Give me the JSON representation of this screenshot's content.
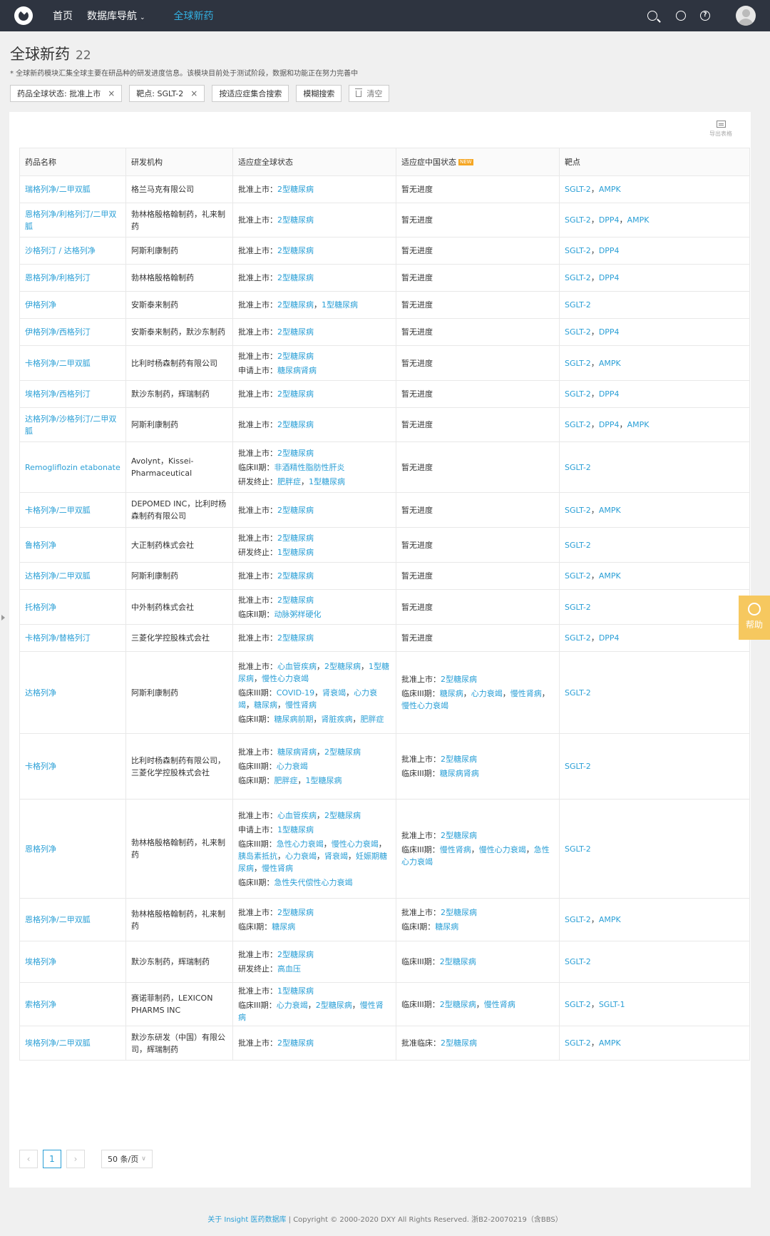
{
  "nav": {
    "items": [
      "首页",
      "数据库导航",
      "全球新药"
    ],
    "caret": "⌄"
  },
  "header": {
    "title": "全球新药",
    "count": "22",
    "desc": "* 全球新药模块汇集全球主要在研品种的研发进度信息。该模块目前处于测试阶段，数据和功能正在努力完善中"
  },
  "filters": {
    "status": "药品全球状态: 批准上市",
    "target": "靶点: SGLT-2",
    "close": "×",
    "indication_search": "按适应症集合搜索",
    "fuzzy_search": "模糊搜索",
    "clear": "清空"
  },
  "export_label": "导出表格",
  "table": {
    "headers": [
      "药品名称",
      "研发机构",
      "适应症全球状态",
      "适应症中国状态",
      "靶点"
    ],
    "new_badge": "NEW",
    "rows": [
      {
        "drug": "瑞格列净/二甲双胍",
        "org": "格兰马克有限公司",
        "global": [
          {
            "label": "批准上市：",
            "items": [
              "2型糖尿病"
            ]
          }
        ],
        "china": [
          {
            "label": "暂无进度",
            "items": []
          }
        ],
        "targets": [
          "SGLT-2",
          "AMPK"
        ]
      },
      {
        "drug": "恩格列净/利格列汀/二甲双胍",
        "org": "勃林格殷格翰制药，礼来制药",
        "global": [
          {
            "label": "批准上市：",
            "items": [
              "2型糖尿病"
            ]
          }
        ],
        "china": [
          {
            "label": "暂无进度",
            "items": []
          }
        ],
        "targets": [
          "SGLT-2",
          "DPP4",
          "AMPK"
        ]
      },
      {
        "drug": "沙格列汀 / 达格列净",
        "org": "阿斯利康制药",
        "global": [
          {
            "label": "批准上市：",
            "items": [
              "2型糖尿病"
            ]
          }
        ],
        "china": [
          {
            "label": "暂无进度",
            "items": []
          }
        ],
        "targets": [
          "SGLT-2",
          "DPP4"
        ]
      },
      {
        "drug": "恩格列净/利格列汀",
        "org": "勃林格殷格翰制药",
        "global": [
          {
            "label": "批准上市：",
            "items": [
              "2型糖尿病"
            ]
          }
        ],
        "china": [
          {
            "label": "暂无进度",
            "items": []
          }
        ],
        "targets": [
          "SGLT-2",
          "DPP4"
        ]
      },
      {
        "drug": "伊格列净",
        "org": "安斯泰来制药",
        "global": [
          {
            "label": "批准上市：",
            "items": [
              "2型糖尿病",
              "1型糖尿病"
            ]
          }
        ],
        "china": [
          {
            "label": "暂无进度",
            "items": []
          }
        ],
        "targets": [
          "SGLT-2"
        ]
      },
      {
        "drug": "伊格列净/西格列汀",
        "org": "安斯泰来制药，默沙东制药",
        "global": [
          {
            "label": "批准上市：",
            "items": [
              "2型糖尿病"
            ]
          }
        ],
        "china": [
          {
            "label": "暂无进度",
            "items": []
          }
        ],
        "targets": [
          "SGLT-2",
          "DPP4"
        ]
      },
      {
        "drug": "卡格列净/二甲双胍",
        "org": "比利时杨森制药有限公司",
        "global": [
          {
            "label": "批准上市：",
            "items": [
              "2型糖尿病"
            ]
          },
          {
            "label": "申请上市：",
            "items": [
              "糖尿病肾病"
            ]
          }
        ],
        "china": [
          {
            "label": "暂无进度",
            "items": []
          }
        ],
        "targets": [
          "SGLT-2",
          "AMPK"
        ]
      },
      {
        "drug": "埃格列净/西格列汀",
        "org": "默沙东制药，辉瑞制药",
        "global": [
          {
            "label": "批准上市：",
            "items": [
              "2型糖尿病"
            ]
          }
        ],
        "china": [
          {
            "label": "暂无进度",
            "items": []
          }
        ],
        "targets": [
          "SGLT-2",
          "DPP4"
        ]
      },
      {
        "drug": "达格列净/沙格列汀/二甲双胍",
        "org": "阿斯利康制药",
        "global": [
          {
            "label": "批准上市：",
            "items": [
              "2型糖尿病"
            ]
          }
        ],
        "china": [
          {
            "label": "暂无进度",
            "items": []
          }
        ],
        "targets": [
          "SGLT-2",
          "DPP4",
          "AMPK"
        ]
      },
      {
        "drug": "Remogliflozin etabonate",
        "org": "Avolynt，Kissei-Pharmaceutical",
        "global": [
          {
            "label": "批准上市：",
            "items": [
              "2型糖尿病"
            ]
          },
          {
            "label": "临床II期：",
            "items": [
              "非酒精性脂肪性肝炎"
            ]
          },
          {
            "label": "研发终止：",
            "items": [
              "肥胖症",
              "1型糖尿病"
            ]
          }
        ],
        "china": [
          {
            "label": "暂无进度",
            "items": []
          }
        ],
        "targets": [
          "SGLT-2"
        ]
      },
      {
        "drug": "卡格列净/二甲双胍",
        "org": "DEPOMED INC，比利时杨森制药有限公司",
        "global": [
          {
            "label": "批准上市：",
            "items": [
              "2型糖尿病"
            ]
          }
        ],
        "china": [
          {
            "label": "暂无进度",
            "items": []
          }
        ],
        "targets": [
          "SGLT-2",
          "AMPK"
        ]
      },
      {
        "drug": "鲁格列净",
        "org": "大正制药株式会社",
        "global": [
          {
            "label": "批准上市：",
            "items": [
              "2型糖尿病"
            ]
          },
          {
            "label": "研发终止：",
            "items": [
              "1型糖尿病"
            ]
          }
        ],
        "china": [
          {
            "label": "暂无进度",
            "items": []
          }
        ],
        "targets": [
          "SGLT-2"
        ]
      },
      {
        "drug": "达格列净/二甲双胍",
        "org": "阿斯利康制药",
        "global": [
          {
            "label": "批准上市：",
            "items": [
              "2型糖尿病"
            ]
          }
        ],
        "china": [
          {
            "label": "暂无进度",
            "items": []
          }
        ],
        "targets": [
          "SGLT-2",
          "AMPK"
        ]
      },
      {
        "drug": "托格列净",
        "org": "中外制药株式会社",
        "global": [
          {
            "label": "批准上市：",
            "items": [
              "2型糖尿病"
            ]
          },
          {
            "label": "临床II期：",
            "items": [
              "动脉粥样硬化"
            ]
          }
        ],
        "china": [
          {
            "label": "暂无进度",
            "items": []
          }
        ],
        "targets": [
          "SGLT-2"
        ]
      },
      {
        "drug": "卡格列净/替格列汀",
        "org": "三菱化学控股株式会社",
        "global": [
          {
            "label": "批准上市：",
            "items": [
              "2型糖尿病"
            ]
          }
        ],
        "china": [
          {
            "label": "暂无进度",
            "items": []
          }
        ],
        "targets": [
          "SGLT-2",
          "DPP4"
        ]
      },
      {
        "drug": "达格列净",
        "org": "阿斯利康制药",
        "global": [
          {
            "label": "批准上市：",
            "items": [
              "心血管疾病",
              "2型糖尿病",
              "1型糖尿病",
              "慢性心力衰竭"
            ]
          },
          {
            "label": "临床III期：",
            "items": [
              "COVID-19",
              "肾衰竭",
              "心力衰竭",
              "糖尿病",
              "慢性肾病"
            ]
          },
          {
            "label": "临床II期：",
            "items": [
              "糖尿病前期",
              "肾脏疾病",
              "肥胖症"
            ]
          }
        ],
        "china": [
          {
            "label": "批准上市：",
            "items": [
              "2型糖尿病"
            ]
          },
          {
            "label": "临床III期：",
            "items": [
              "糖尿病",
              "心力衰竭",
              "慢性肾病",
              "慢性心力衰竭"
            ]
          }
        ],
        "targets": [
          "SGLT-2"
        ]
      },
      {
        "drug": "卡格列净",
        "org": "比利时杨森制药有限公司，三菱化学控股株式会社",
        "global": [
          {
            "label": "批准上市：",
            "items": [
              "糖尿病肾病",
              "2型糖尿病"
            ]
          },
          {
            "label": "临床III期：",
            "items": [
              "心力衰竭"
            ]
          },
          {
            "label": "临床II期：",
            "items": [
              "肥胖症",
              "1型糖尿病"
            ]
          }
        ],
        "china": [
          {
            "label": "批准上市：",
            "items": [
              "2型糖尿病"
            ]
          },
          {
            "label": "临床III期：",
            "items": [
              "糖尿病肾病"
            ]
          }
        ],
        "targets": [
          "SGLT-2"
        ]
      },
      {
        "drug": "恩格列净",
        "org": "勃林格殷格翰制药，礼来制药",
        "global": [
          {
            "label": "批准上市：",
            "items": [
              "心血管疾病",
              "2型糖尿病"
            ]
          },
          {
            "label": "申请上市：",
            "items": [
              "1型糖尿病"
            ]
          },
          {
            "label": "临床III期：",
            "items": [
              "急性心力衰竭",
              "慢性心力衰竭",
              "胰岛素抵抗",
              "心力衰竭",
              "肾衰竭",
              "妊娠期糖尿病",
              "慢性肾病"
            ]
          },
          {
            "label": "临床II期：",
            "items": [
              "急性失代偿性心力衰竭"
            ]
          }
        ],
        "china": [
          {
            "label": "批准上市：",
            "items": [
              "2型糖尿病"
            ]
          },
          {
            "label": "临床III期：",
            "items": [
              "慢性肾病",
              "慢性心力衰竭",
              "急性心力衰竭"
            ]
          }
        ],
        "targets": [
          "SGLT-2"
        ]
      },
      {
        "drug": "恩格列净/二甲双胍",
        "org": "勃林格殷格翰制药，礼来制药",
        "global": [
          {
            "label": "批准上市：",
            "items": [
              "2型糖尿病"
            ]
          },
          {
            "label": "临床I期：",
            "items": [
              "糖尿病"
            ]
          }
        ],
        "china": [
          {
            "label": "批准上市：",
            "items": [
              "2型糖尿病"
            ]
          },
          {
            "label": "临床I期：",
            "items": [
              "糖尿病"
            ]
          }
        ],
        "targets": [
          "SGLT-2",
          "AMPK"
        ]
      },
      {
        "drug": "埃格列净",
        "org": "默沙东制药，辉瑞制药",
        "global": [
          {
            "label": "批准上市：",
            "items": [
              "2型糖尿病"
            ]
          },
          {
            "label": "研发终止：",
            "items": [
              "高血压"
            ]
          }
        ],
        "china": [
          {
            "label": "临床III期：",
            "items": [
              "2型糖尿病"
            ]
          }
        ],
        "targets": [
          "SGLT-2"
        ]
      },
      {
        "drug": "索格列净",
        "org": "赛诺菲制药，LEXICON PHARMS INC",
        "global": [
          {
            "label": "批准上市：",
            "items": [
              "1型糖尿病"
            ]
          },
          {
            "label": "临床III期：",
            "items": [
              "心力衰竭",
              "2型糖尿病",
              "慢性肾病"
            ]
          }
        ],
        "china": [
          {
            "label": "临床III期：",
            "items": [
              "2型糖尿病",
              "慢性肾病"
            ]
          }
        ],
        "targets": [
          "SGLT-2",
          "SGLT-1"
        ]
      },
      {
        "drug": "埃格列净/二甲双胍",
        "org": "默沙东研发（中国）有限公司，辉瑞制药",
        "global": [
          {
            "label": "批准上市：",
            "items": [
              "2型糖尿病"
            ]
          }
        ],
        "china": [
          {
            "label": "批准临床：",
            "items": [
              "2型糖尿病"
            ]
          }
        ],
        "targets": [
          "SGLT-2",
          "AMPK"
        ]
      }
    ]
  },
  "pager": {
    "prev": "‹",
    "page": "1",
    "next": "›",
    "size": "50 条/页",
    "caret": "∨"
  },
  "help_label": "帮助",
  "footer": {
    "link": "关于 Insight 医药数据库",
    "text": " | Copyright © 2000-2020 DXY All Rights Reserved. 浙B2-20070219（含BBS）"
  }
}
